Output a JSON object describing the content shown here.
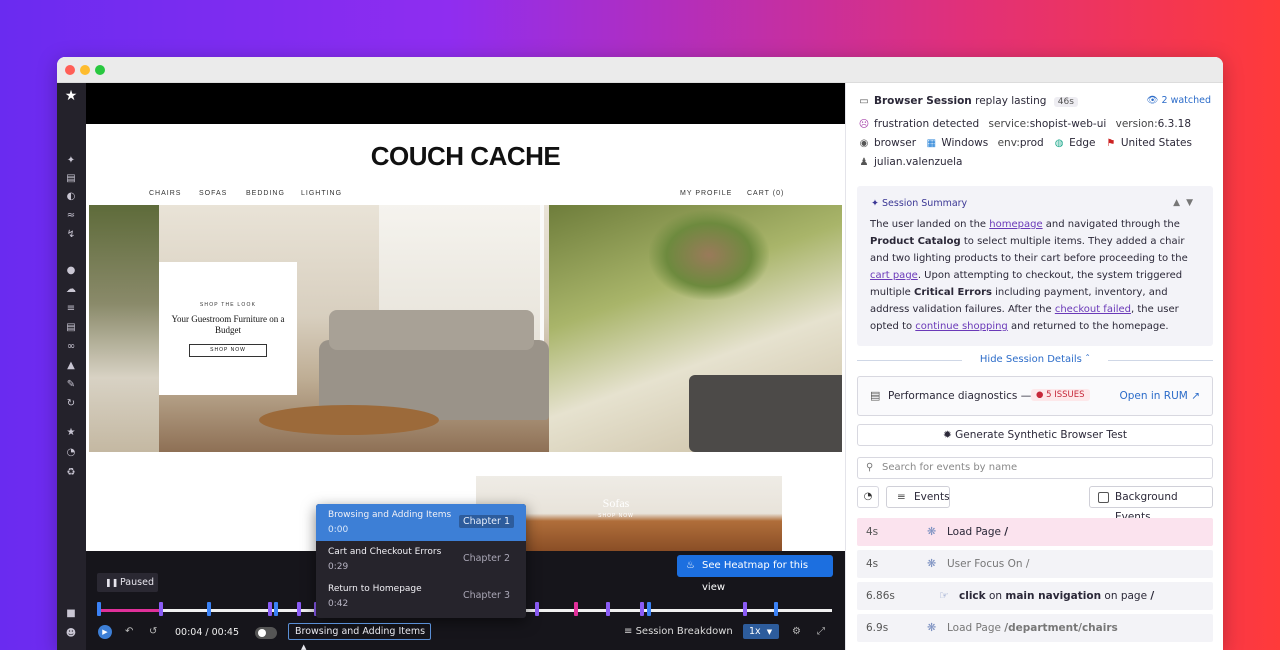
{
  "rail": {
    "logo_icon": "dog-logo-icon",
    "icons": [
      "sparkle-icon",
      "chart-icon",
      "gauge-icon",
      "apm-icon",
      "lightning-icon",
      "network-icon",
      "cloud-icon",
      "list-icon",
      "stack-icon",
      "link-icon",
      "shield-icon",
      "search-doc-icon",
      "refresh-icon",
      "bug-icon",
      "speedometer-icon",
      "integrations-icon"
    ],
    "bottom_icons": [
      "puzzle-icon",
      "user-icon"
    ]
  },
  "site": {
    "brand": "COUCH CACHE",
    "nav_left": [
      "CHAIRS",
      "SOFAS",
      "BEDDING",
      "LIGHTING"
    ],
    "nav_right": [
      "MY PROFILE",
      "CART (0)"
    ],
    "card_kicker": "SHOP THE LOOK",
    "card_title": "Your Guestroom Furniture on a Budget",
    "card_button": "SHOP NOW",
    "promo_title": "Sofas",
    "promo_sub": "SHOP NOW"
  },
  "player": {
    "heatmap_label": "See Heatmap for this view",
    "paused_label": "Paused",
    "chapters": [
      {
        "name": "Browsing and Adding Items",
        "time": "0:00",
        "badge": "Chapter 1"
      },
      {
        "name": "Cart and Checkout Errors",
        "time": "0:29",
        "badge": "Chapter 2"
      },
      {
        "name": "Return to Homepage",
        "time": "0:42",
        "badge": "Chapter 3"
      }
    ],
    "progress_fraction": 0.089,
    "timecode": "00:04 / 00:45",
    "chapter_select": "Browsing and Adding Items",
    "breakdown_label": "Session Breakdown",
    "speed": "1x",
    "colors": {
      "accent": "#3d7fd6",
      "progress": "#e0309a",
      "marker_purple": "#8b5cf6",
      "marker_blue": "#3b82f6"
    }
  },
  "panel": {
    "session_type": "Browser Session",
    "replay_text": "replay lasting",
    "duration": "46s",
    "watched": "2 watched",
    "tags_row1": [
      {
        "icon": "frustration-icon",
        "text": "frustration detected"
      },
      {
        "key": "service:",
        "val": "shopist-web-ui"
      },
      {
        "key": "version:",
        "val": "6.3.18"
      }
    ],
    "tags_row2": [
      {
        "icon": "globe-icon",
        "text": "browser"
      },
      {
        "icon": "windows-icon",
        "text": "Windows"
      },
      {
        "key": "env:",
        "val": "prod"
      },
      {
        "icon": "edge-icon",
        "text": "Edge"
      },
      {
        "icon": "us-flag-icon",
        "text": "United States"
      }
    ],
    "user": "julian.valenzuela",
    "summary_title": "Session Summary",
    "summary": {
      "p1": "The user landed on the ",
      "l1": "homepage",
      "p2": " and navigated through the ",
      "b1": "Product Catalog",
      "p3": " to select multiple items. They added a chair and two lighting products to their cart before proceeding to the ",
      "l2": "cart page",
      "p4": ". Upon attempting to checkout, the system triggered multiple ",
      "b2": "Critical Errors",
      "p5": " including payment, inventory, and address validation failures. After the ",
      "l3": "checkout failed",
      "p6": ", the user opted to ",
      "l4": "continue shopping",
      "p7": " and returned to the homepage."
    },
    "hide_details": "Hide Session Details",
    "perf_label": "Performance diagnostics",
    "perf_dash": "—",
    "issues": "5 ISSUES",
    "open_rum": "Open in RUM",
    "generate": "Generate Synthetic Browser Test",
    "search_placeholder": "Search for events by name",
    "events_btn": "Events",
    "background_btn": "Background Events",
    "events": [
      {
        "time": "4s",
        "icon": "loading-icon",
        "pre": "Load Page ",
        "bold": "/",
        "post": "",
        "highlight": true,
        "muted": false
      },
      {
        "time": "4s",
        "icon": "loading-icon",
        "pre": "User Focus On ",
        "bold": "",
        "post": "/",
        "highlight": false,
        "muted": true
      },
      {
        "time": "6.86s",
        "icon": "click-icon",
        "pre": "",
        "bold": "click",
        "post": "",
        "mid": " on ",
        "bold2": "main navigation",
        "tail": " on page ",
        "bold3": "/",
        "highlight": false,
        "muted": false
      },
      {
        "time": "6.9s",
        "icon": "loading-icon",
        "pre": "Load Page ",
        "bold": "/department/chairs",
        "post": "",
        "highlight": false,
        "muted": true
      }
    ]
  }
}
